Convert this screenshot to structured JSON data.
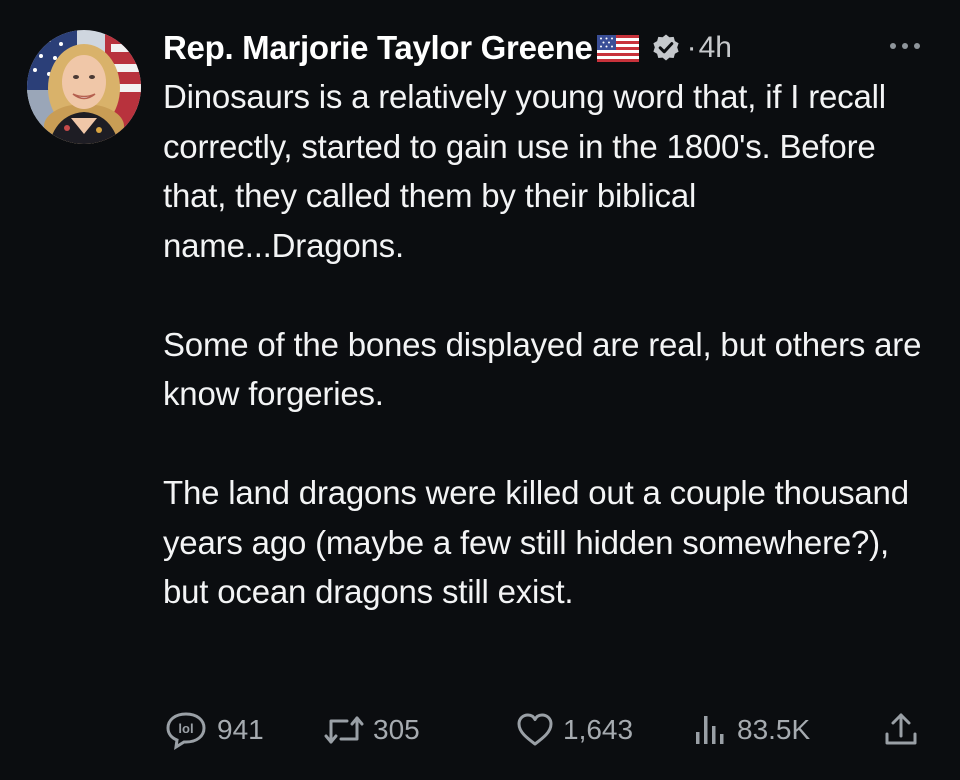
{
  "author": {
    "name": "Rep. Marjorie Taylor Greene",
    "flag_emoji_icon": "us-flag-icon",
    "verified_icon": "verified-badge-icon",
    "separator": "·",
    "time": "4h",
    "more_icon": "more-horizontal-icon"
  },
  "tweet": {
    "paragraphs": [
      "Dinosaurs is a relatively young word that, if I recall correctly, started to gain use in the 1800's. Before that, they called them by their biblical name...Dragons.",
      "Some of the bones displayed are real, but others are know forgeries.",
      "The land dragons were killed out a couple thousand years ago (maybe a few still hidden somewhere?), but ocean dragons still exist."
    ]
  },
  "actions": {
    "reply": {
      "icon": "reply-bubble-lol-icon",
      "count": "941"
    },
    "retweet": {
      "icon": "retweet-icon",
      "count": "305"
    },
    "like": {
      "icon": "heart-icon",
      "count": "1,643"
    },
    "views": {
      "icon": "views-bar-chart-icon",
      "count": "83.5K"
    },
    "share": {
      "icon": "share-icon"
    }
  },
  "colors": {
    "background": "#0b0d10",
    "text": "#e7e9ea",
    "muted": "#9aa0a6",
    "verified_badge": "#c5c8cc"
  }
}
